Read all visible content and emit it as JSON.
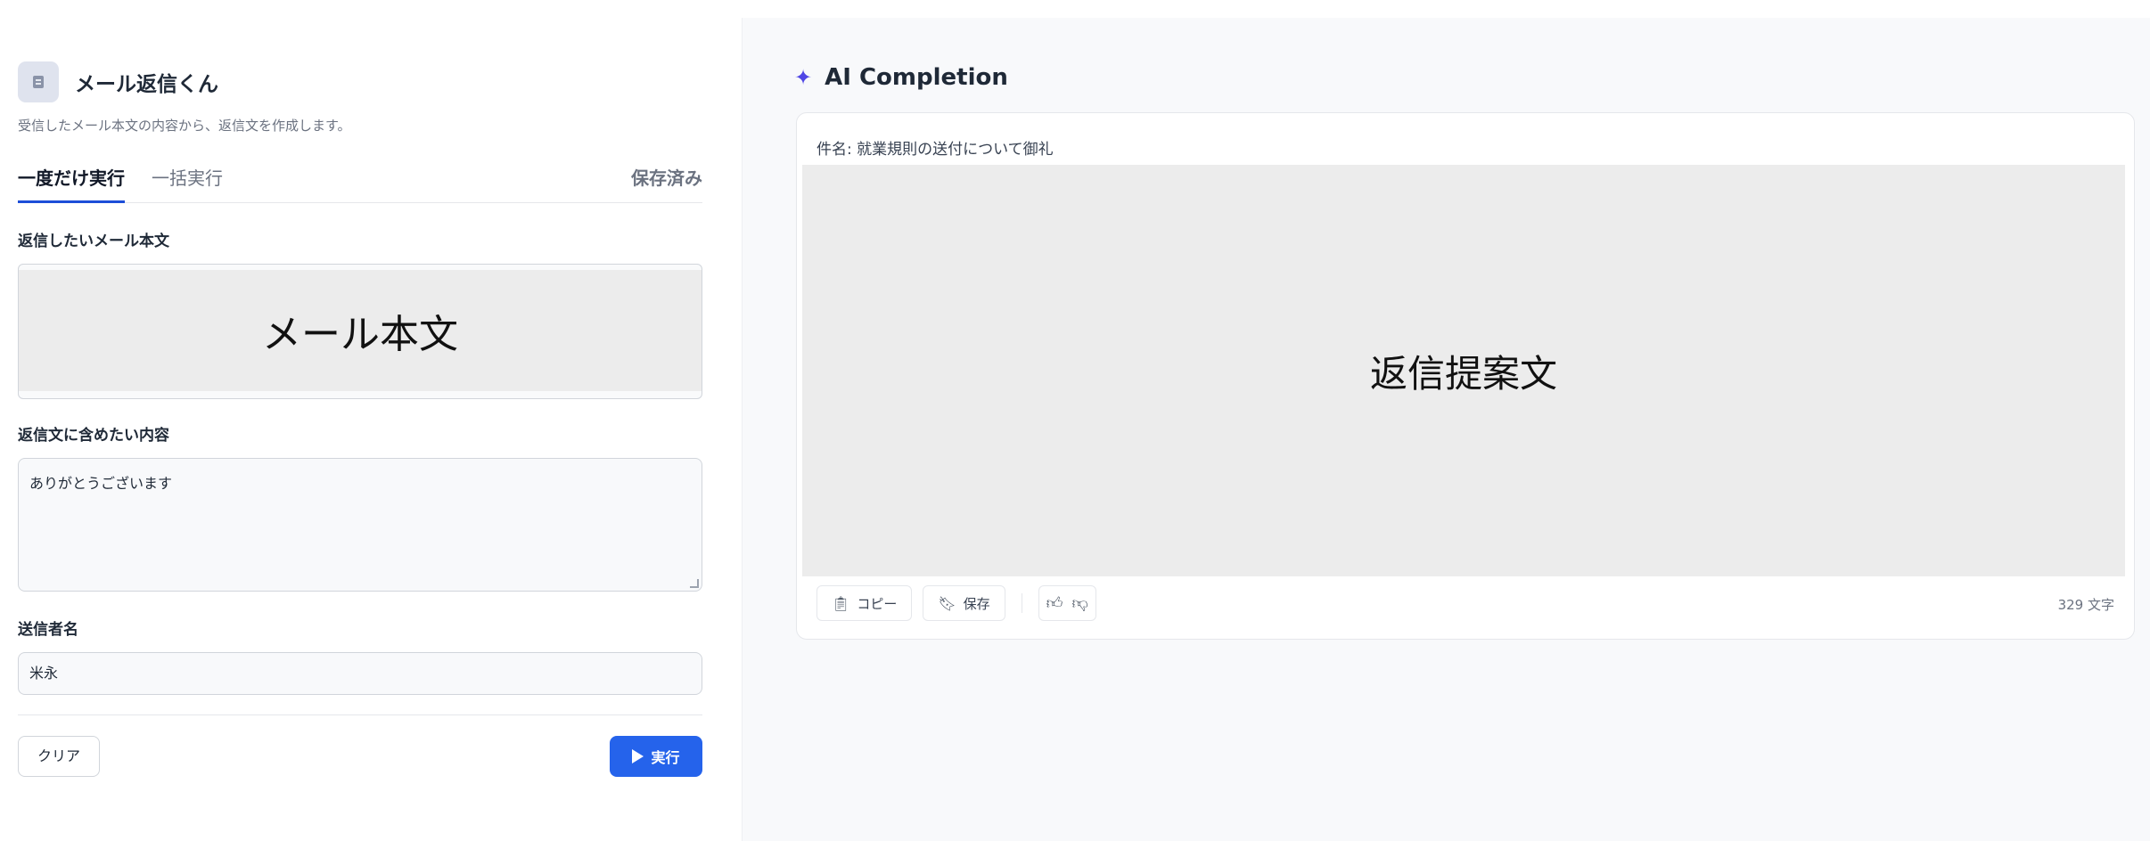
{
  "app": {
    "icon": "document-icon",
    "title": "メール返信くん",
    "description": "受信したメール本文の内容から、返信文を作成します。"
  },
  "tabs": [
    {
      "label": "一度だけ実行",
      "active": true
    },
    {
      "label": "一括実行",
      "active": false
    },
    {
      "label": "保存済み",
      "active": false
    }
  ],
  "form": {
    "mail_body_label": "返信したいメール本文",
    "mail_body_placeholder": "メール本文",
    "include_label": "返信文に含めたい内容",
    "include_value": "ありがとうございます",
    "sender_label": "送信者名",
    "sender_value": "米永",
    "clear_label": "クリア",
    "run_label": "実行"
  },
  "completion": {
    "title": "AI Completion",
    "subject": "件名: 就業規則の送付について御礼",
    "reply_placeholder": "返信提案文",
    "copy_label": "コピー",
    "save_label": "保存",
    "char_count": "329 文字"
  },
  "colors": {
    "accent": "#2563eb",
    "tab_underline": "#1d4ed8",
    "sparkle": "#4f46e5"
  }
}
